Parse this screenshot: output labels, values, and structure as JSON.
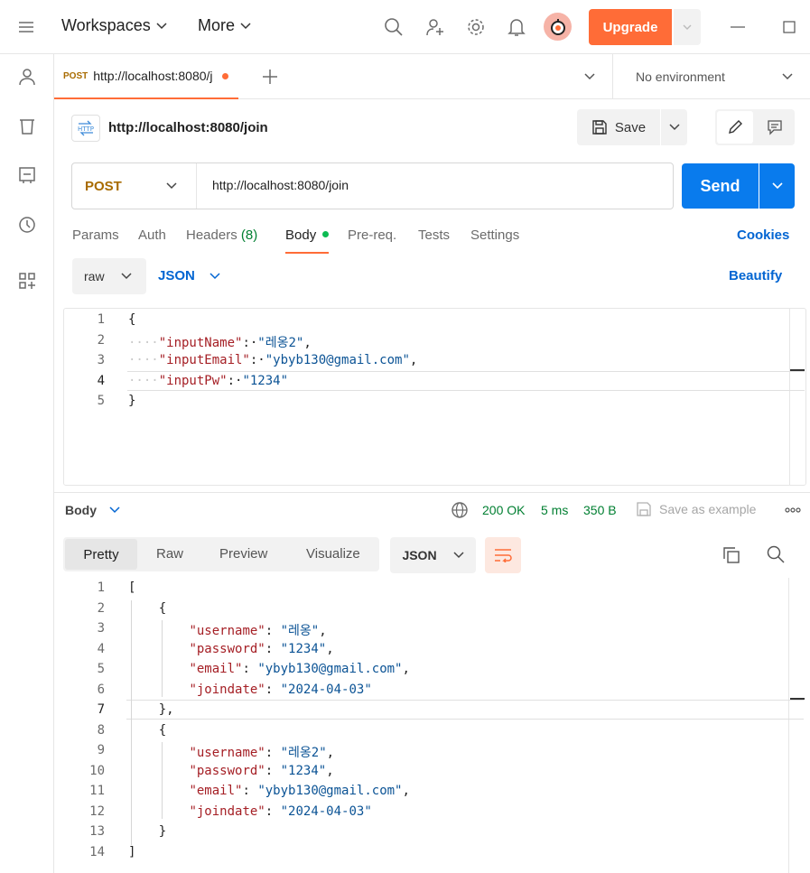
{
  "topbar": {
    "workspaces_label": "Workspaces",
    "more_label": "More",
    "upgrade_label": "Upgrade"
  },
  "tabs": {
    "active": {
      "method": "POST",
      "title": "http://localhost:8080/j"
    },
    "environment": "No environment"
  },
  "request": {
    "name": "http://localhost:8080/join",
    "save_label": "Save",
    "method": "POST",
    "url": "http://localhost:8080/join",
    "send_label": "Send",
    "tabs": [
      "Params",
      "Auth",
      "Headers",
      "Body",
      "Pre-req.",
      "Tests",
      "Settings"
    ],
    "headers_count": "(8)",
    "cookies_label": "Cookies",
    "body_mode": "raw",
    "body_lang": "JSON",
    "beautify_label": "Beautify",
    "body_lines": [
      [
        "{"
      ],
      [
        "····",
        "\"inputName\"",
        ":·",
        "\"레옹2\"",
        ","
      ],
      [
        "····",
        "\"inputEmail\"",
        ":·",
        "\"ybyb130@gmail.com\"",
        ","
      ],
      [
        "····",
        "\"inputPw\"",
        ":·",
        "\"1234\"",
        ""
      ],
      [
        "}"
      ]
    ]
  },
  "response": {
    "section_label": "Body",
    "status": "200 OK",
    "time": "5 ms",
    "size": "350 B",
    "save_example_label": "Save as example",
    "view_tabs": [
      "Pretty",
      "Raw",
      "Preview",
      "Visualize"
    ],
    "format": "JSON",
    "lines": [
      "[",
      "    {",
      "        \"username\": \"레옹\",",
      "        \"password\": \"1234\",",
      "        \"email\": \"ybyb130@gmail.com\",",
      "        \"joindate\": \"2024-04-03\"",
      "    },",
      "    {",
      "        \"username\": \"레옹2\",",
      "        \"password\": \"1234\",",
      "        \"email\": \"ybyb130@gmail.com\",",
      "        \"joindate\": \"2024-04-03\"",
      "    }",
      "]"
    ]
  },
  "colors": {
    "accent_orange": "#ff6c37",
    "send_blue": "#097bed",
    "status_green": "#007f31",
    "key_red": "#a51f25",
    "string_blue": "#0b5395"
  }
}
